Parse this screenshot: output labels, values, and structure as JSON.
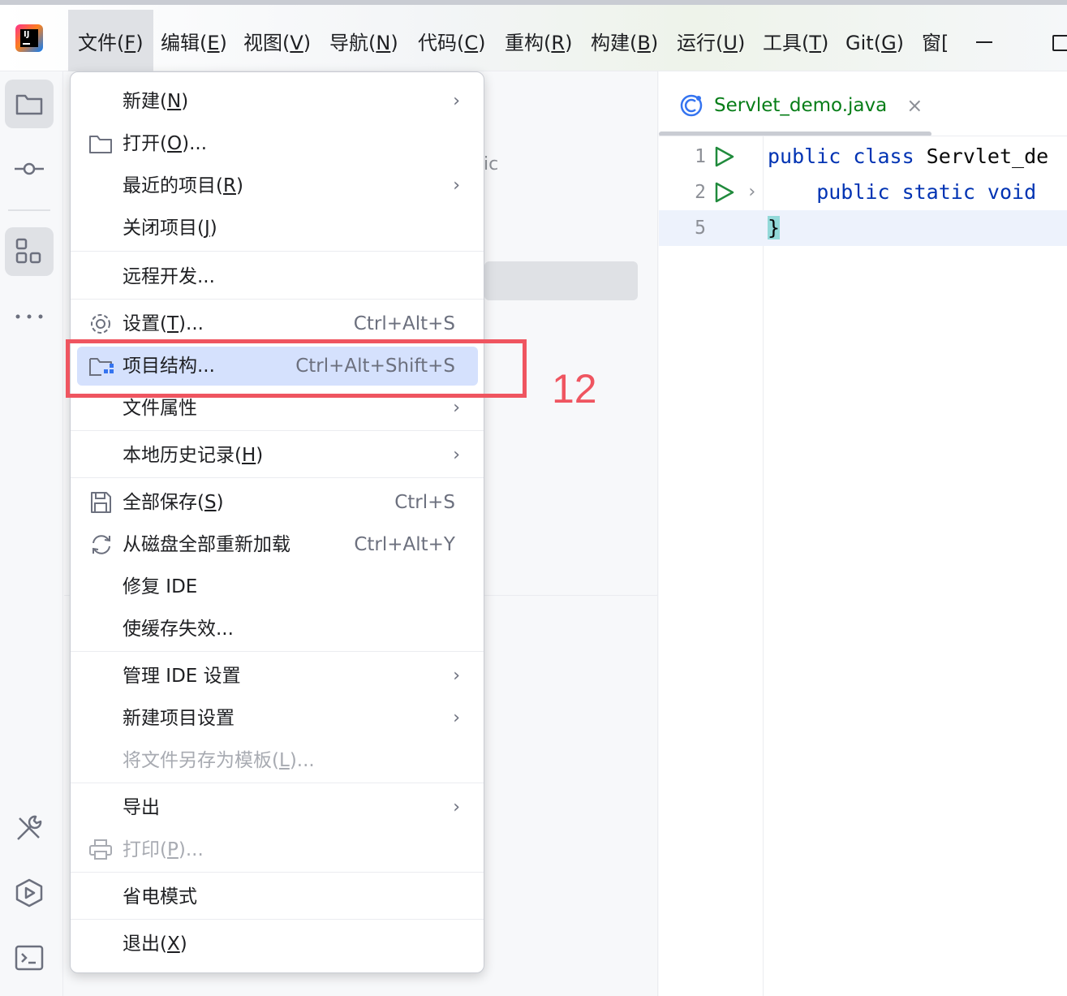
{
  "menubar": {
    "items": [
      {
        "name": "menu-file",
        "label": "文件",
        "mnemonic": "F"
      },
      {
        "name": "menu-edit",
        "label": "编辑",
        "mnemonic": "E"
      },
      {
        "name": "menu-view",
        "label": "视图",
        "mnemonic": "V"
      },
      {
        "name": "menu-navigate",
        "label": "导航",
        "mnemonic": "N"
      },
      {
        "name": "menu-code",
        "label": "代码",
        "mnemonic": "C"
      },
      {
        "name": "menu-refactor",
        "label": "重构",
        "mnemonic": "R"
      },
      {
        "name": "menu-build",
        "label": "构建",
        "mnemonic": "B"
      },
      {
        "name": "menu-run",
        "label": "运行",
        "mnemonic": "U"
      },
      {
        "name": "menu-tools",
        "label": "工具",
        "mnemonic": "T"
      },
      {
        "name": "menu-git",
        "label": "Git",
        "mnemonic": "G"
      },
      {
        "name": "menu-window",
        "label": "窗[",
        "mnemonic": ""
      }
    ]
  },
  "project_panel": {
    "fragment": "ic"
  },
  "editor": {
    "tab_label": "Servlet_demo.java",
    "tab_close": "×",
    "lines": [
      {
        "num": "1",
        "text": "public class Servlet_de"
      },
      {
        "num": "2",
        "text": "    public static void"
      },
      {
        "num": "5",
        "text": "}"
      }
    ]
  },
  "file_menu": {
    "new": {
      "label": "新建",
      "mnemonic": "N",
      "suffix": ""
    },
    "open": {
      "label": "打开",
      "mnemonic": "O",
      "suffix": "..."
    },
    "recent": {
      "label": "最近的项目",
      "mnemonic": "R",
      "suffix": ""
    },
    "close": {
      "label": "关闭项目",
      "mnemonic": "J",
      "suffix": ""
    },
    "remote": {
      "label": "远程开发..."
    },
    "settings": {
      "label": "设置",
      "mnemonic": "T",
      "suffix": "...",
      "shortcut": "Ctrl+Alt+S"
    },
    "project_structure": {
      "label": "项目结构...",
      "shortcut": "Ctrl+Alt+Shift+S"
    },
    "file_props": {
      "label": "文件属性"
    },
    "local_history": {
      "label": "本地历史记录",
      "mnemonic": "H",
      "suffix": ""
    },
    "save_all": {
      "label": "全部保存",
      "mnemonic": "S",
      "suffix": "",
      "shortcut": "Ctrl+S"
    },
    "reload": {
      "label": "从磁盘全部重新加载",
      "shortcut": "Ctrl+Alt+Y"
    },
    "repair": {
      "label": "修复 IDE"
    },
    "invalidate": {
      "label": "使缓存失效..."
    },
    "manage_ide": {
      "label": "管理 IDE 设置"
    },
    "new_project_settings": {
      "label": "新建项目设置"
    },
    "save_template": {
      "label": "将文件另存为模板",
      "mnemonic": "L",
      "suffix": "..."
    },
    "export": {
      "label": "导出"
    },
    "print": {
      "label": "打印",
      "mnemonic": "P",
      "suffix": "..."
    },
    "power_save": {
      "label": "省电模式"
    },
    "exit": {
      "label": "退出",
      "mnemonic": "X",
      "suffix": ""
    }
  },
  "annotation": {
    "number": "12",
    "color": "#ef5560"
  },
  "colors": {
    "selection": "#d5e1fd",
    "keyword": "#0033b3",
    "tab_text": "#067d17"
  }
}
